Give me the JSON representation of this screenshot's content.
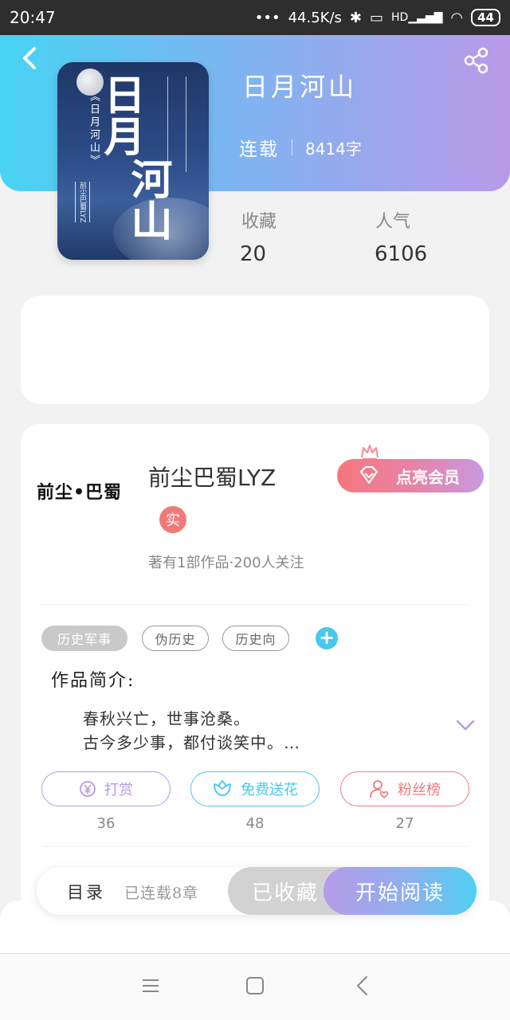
{
  "status_bar": {
    "time": "20:47",
    "network_speed": "44.5K/s",
    "network_type": "HD",
    "battery": "44"
  },
  "book": {
    "title": "日月河山",
    "status": "连载",
    "word_count": "8414字",
    "cover": {
      "title_line1": "日月",
      "title_line2": "河山",
      "subtitle": "《日月河山》",
      "author": "前尘巴蜀LYZ"
    },
    "stats": {
      "favorites_label": "收藏",
      "favorites_value": "20",
      "popularity_label": "人气",
      "popularity_value": "6106"
    }
  },
  "author": {
    "logo_text": "前尘•巴蜀",
    "name": "前尘巴蜀LYZ",
    "badge": "实",
    "summary": "著有1部作品·200人关注",
    "vip_button": "点亮会员"
  },
  "tags": [
    {
      "label": "历史军事"
    },
    {
      "label": "伪历史"
    },
    {
      "label": "历史向"
    }
  ],
  "intro": {
    "heading": "作品简介:",
    "line1": "春秋兴亡，世事沧桑。",
    "line2": "古今多少事，都付谈笑中。…"
  },
  "actions": [
    {
      "label": "打赏",
      "count": "36",
      "icon": "yen-coin-icon",
      "color": "#b79ae2"
    },
    {
      "label": "免费送花",
      "count": "48",
      "icon": "flower-icon",
      "color": "#48c8ef"
    },
    {
      "label": "粉丝榜",
      "count": "27",
      "icon": "user-heart-icon",
      "color": "#f07a7a"
    }
  ],
  "bottom_bar": {
    "toc_label": "目录",
    "toc_status": "已连载8章",
    "collected_label": "已收藏",
    "read_label": "开始阅读"
  },
  "colors": {
    "header_gradient_start": "#48d3f3",
    "header_gradient_end": "#b99ae9",
    "accent_blue": "#48c8ef",
    "accent_red": "#f07a7a"
  }
}
